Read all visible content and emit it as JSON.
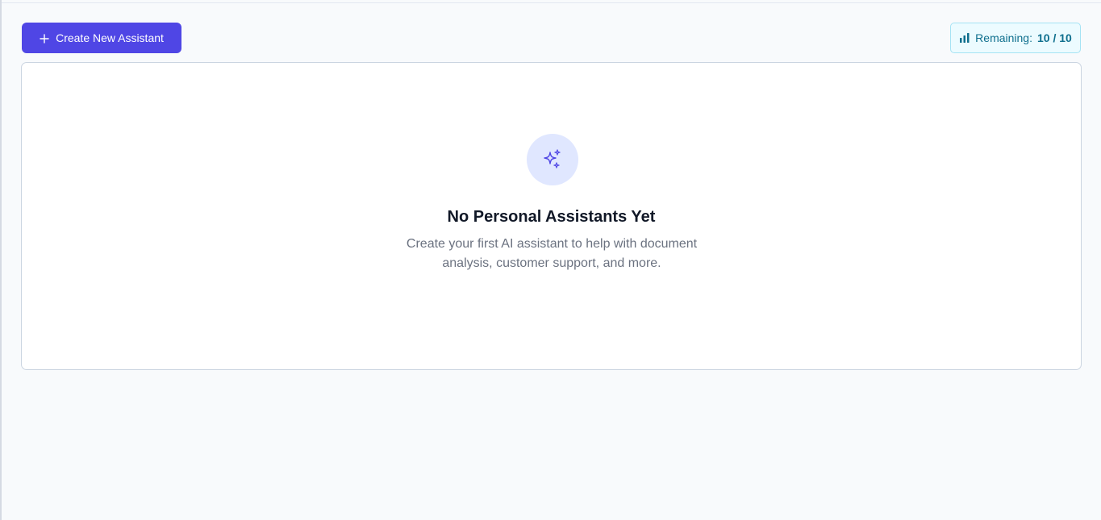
{
  "toolbar": {
    "create_button_label": "Create New Assistant",
    "create_button_icon": "plus-icon",
    "remaining_icon": "bar-chart-icon",
    "remaining_label": "Remaining:",
    "remaining_count": "10 / 10"
  },
  "empty_state": {
    "icon": "sparkles-icon",
    "title": "No Personal Assistants Yet",
    "description": "Create your first AI assistant to help with document analysis, customer support, and more."
  },
  "colors": {
    "primary": "#4f46e5",
    "badge_bg": "#ecfbff",
    "badge_text": "#0e6f8e",
    "icon_bg": "#e0e7ff"
  }
}
